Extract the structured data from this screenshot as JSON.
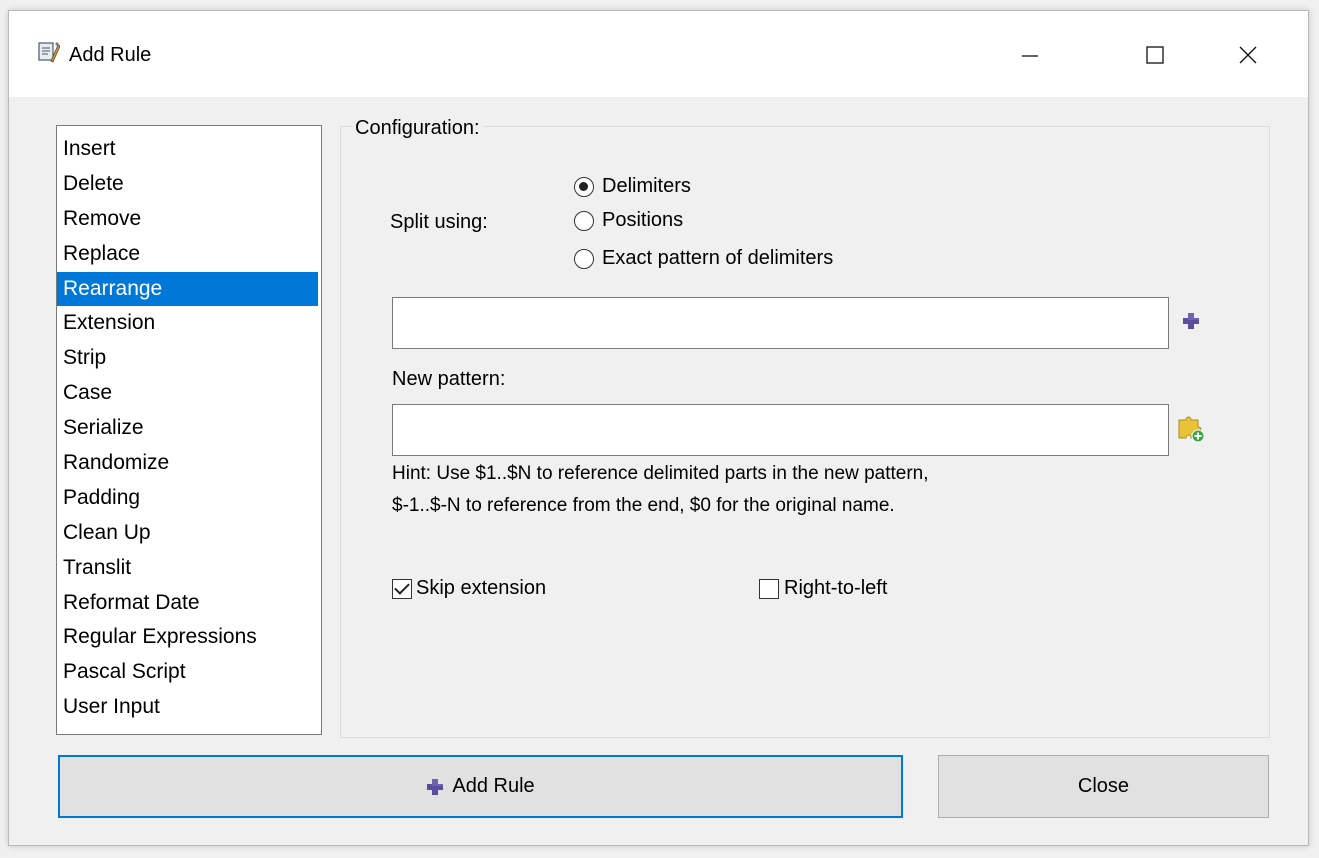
{
  "window": {
    "title": "Add Rule",
    "icon": "rule-wizard-icon",
    "controls": {
      "minimize": "minimize-icon",
      "maximize": "maximize-icon",
      "close": "close-icon"
    }
  },
  "rules": {
    "items": [
      "Insert",
      "Delete",
      "Remove",
      "Replace",
      "Rearrange",
      "Extension",
      "Strip",
      "Case",
      "Serialize",
      "Randomize",
      "Padding",
      "Clean Up",
      "Translit",
      "Reformat Date",
      "Regular Expressions",
      "Pascal Script",
      "User Input"
    ],
    "selected": "Rearrange"
  },
  "config": {
    "group_label": "Configuration:",
    "split_label": "Split using:",
    "split_options": [
      {
        "label": "Delimiters",
        "checked": true
      },
      {
        "label": "Positions",
        "checked": false
      },
      {
        "label": "Exact pattern of delimiters",
        "checked": false
      }
    ],
    "delimiters_value": "",
    "delimiters_button_icon": "plus-icon",
    "new_pattern_label": "New pattern:",
    "new_pattern_value": "",
    "new_pattern_button_icon": "puzzle-add-icon",
    "hint_line1": "Hint: Use $1..$N to reference delimited parts in the new pattern,",
    "hint_line2": "$-1..$-N to reference from the end, $0 for the original name.",
    "skip_extension": {
      "label": "Skip extension",
      "checked": true
    },
    "right_to_left": {
      "label": "Right-to-left",
      "checked": false
    }
  },
  "buttons": {
    "add_rule": "Add Rule",
    "add_rule_icon": "plus-icon",
    "close": "Close"
  },
  "colors": {
    "selection": "#0078d7",
    "plus_icon": "#5b4d9b",
    "puzzle_icon": "#e8c33a"
  }
}
